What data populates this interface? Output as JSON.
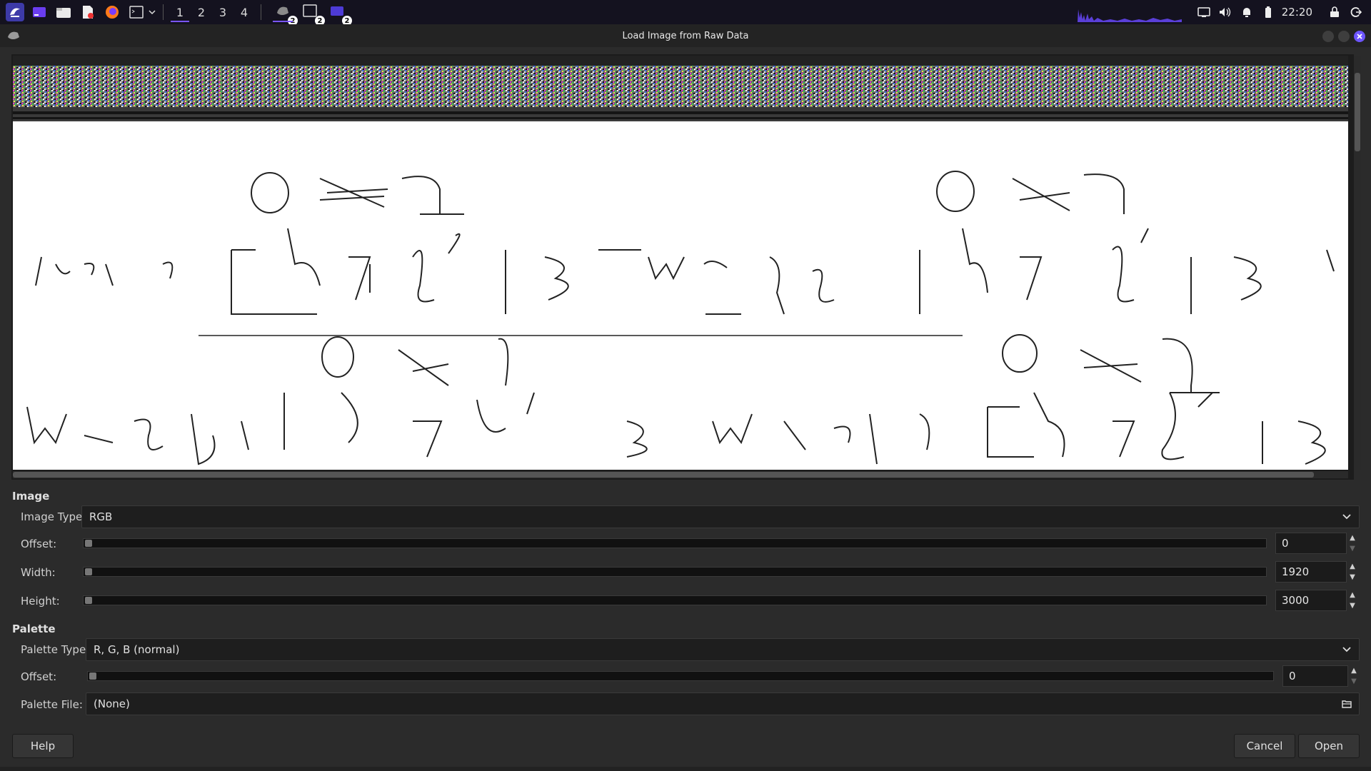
{
  "taskbar": {
    "workspaces": [
      "1",
      "2",
      "3",
      "4"
    ],
    "active_workspace": 0,
    "window_tasks": [
      {
        "icon": "gimp-icon",
        "count": "2"
      },
      {
        "icon": "terminal-icon",
        "count": "2"
      },
      {
        "icon": "files-icon",
        "count": "2"
      }
    ],
    "clock": "22:20"
  },
  "dialog": {
    "title": "Load Image from Raw Data"
  },
  "image_section": {
    "heading": "Image",
    "image_type_label": "Image Type:",
    "image_type_value": "RGB",
    "offset_label": "Offset:",
    "offset_value": "0",
    "width_label": "Width:",
    "width_value": "1920",
    "height_label": "Height:",
    "height_value": "3000"
  },
  "palette_section": {
    "heading": "Palette",
    "palette_type_label": "Palette Type:",
    "palette_type_value": "R, G, B (normal)",
    "offset_label": "Offset:",
    "offset_value": "0",
    "palette_file_label": "Palette File:",
    "palette_file_value": "(None)"
  },
  "buttons": {
    "help": "Help",
    "cancel": "Cancel",
    "open": "Open"
  },
  "colors": {
    "accent": "#7a55ff",
    "panel_bg": "#14121f",
    "dialog_bg": "#2b2b2b"
  }
}
